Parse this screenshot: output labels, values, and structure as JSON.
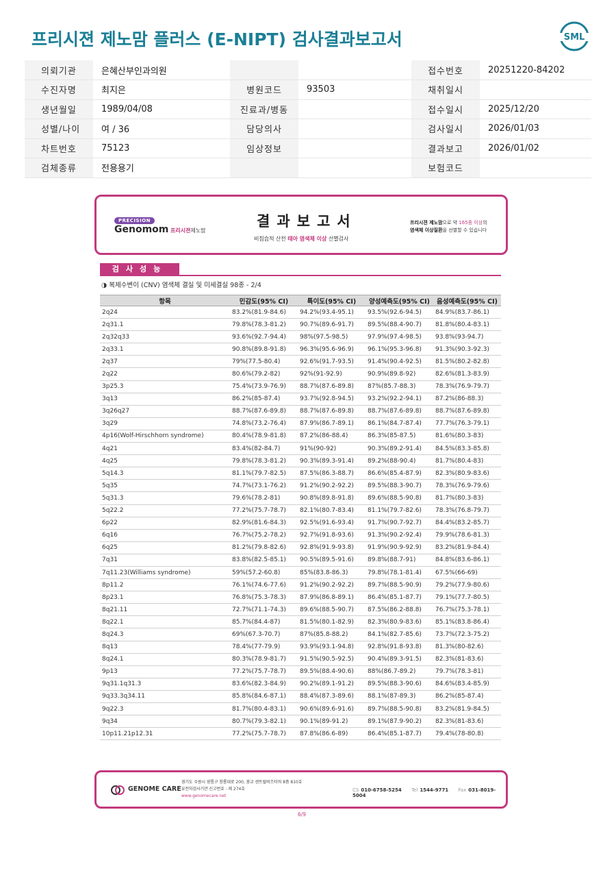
{
  "header": {
    "title": "프리시젼 제노맘 플러스 (E-NIPT) 검사결과보고서",
    "logo_text": "SML"
  },
  "patient_info": {
    "rows": [
      {
        "l1": "의뢰기관",
        "v1": "은혜산부인과의원",
        "l2": "",
        "v2": "",
        "l3": "접수번호",
        "v3": "20251220-84202"
      },
      {
        "l1": "수진자명",
        "v1": "최지은",
        "l2": "병원코드",
        "v2": "93503",
        "l3": "채취일시",
        "v3": ""
      },
      {
        "l1": "생년월일",
        "v1": "1989/04/08",
        "l2": "진료과/병동",
        "v2": "",
        "l3": "접수일시",
        "v3": "2025/12/20"
      },
      {
        "l1": "성별/나이",
        "v1": "여 / 36",
        "l2": "담당의사",
        "v2": "",
        "l3": "검사일시",
        "v3": "2026/01/03"
      },
      {
        "l1": "차트번호",
        "v1": "75123",
        "l2": "임상정보",
        "v2": "",
        "l3": "결과보고",
        "v3": "2026/01/02"
      },
      {
        "l1": "검체종류",
        "v1": "전용용기",
        "l2": "",
        "v2": "",
        "l3": "보험코드",
        "v3": ""
      }
    ]
  },
  "report": {
    "brand_tag": "PRECISION",
    "brand_name": "Genomom",
    "brand_sub_pink": "프리시젼",
    "brand_sub_dark": "제노맘",
    "title": "결과보고서",
    "subtitle_pre": "비침습적 산전 ",
    "subtitle_pink": "태아 염색체 이상",
    "subtitle_post": " 선별검사",
    "note_bold": "프리시젼 제노맘",
    "note_mid": "으로 약 ",
    "note_pink": "165종 이상",
    "note_end": "의",
    "note_line2_bold": "염색체 이상질환",
    "note_line2": "을 선별할 수 있습니다",
    "section_title": "검사성능",
    "section_subtitle": "◑ 복제수변이 (CNV) 염색체 결실 및 미세결실 98종 - 2/4"
  },
  "table": {
    "headers": [
      "항목",
      "민감도(95% CI)",
      "특이도(95% CI)",
      "양성예측도(95% CI)",
      "음성예측도(95% CI)"
    ],
    "rows": [
      [
        "2q24",
        "83.2%(81.9-84.6)",
        "94.2%(93.4-95.1)",
        "93.5%(92.6-94.5)",
        "84.9%(83.7-86.1)"
      ],
      [
        "2q31.1",
        "79.8%(78.3-81.2)",
        "90.7%(89.6-91.7)",
        "89.5%(88.4-90.7)",
        "81.8%(80.4-83.1)"
      ],
      [
        "2q32q33",
        "93.6%(92.7-94.4)",
        "98%(97.5-98.5)",
        "97.9%(97.4-98.5)",
        "93.8%(93-94.7)"
      ],
      [
        "2q33.1",
        "90.8%(89.8-91.8)",
        "96.3%(95.6-96.9)",
        "96.1%(95.3-96.8)",
        "91.3%(90.3-92.3)"
      ],
      [
        "2q37",
        "79%(77.5-80.4)",
        "92.6%(91.7-93.5)",
        "91.4%(90.4-92.5)",
        "81.5%(80.2-82.8)"
      ],
      [
        "2q22",
        "80.6%(79.2-82)",
        "92%(91-92.9)",
        "90.9%(89.8-92)",
        "82.6%(81.3-83.9)"
      ],
      [
        "3p25.3",
        "75.4%(73.9-76.9)",
        "88.7%(87.6-89.8)",
        "87%(85.7-88.3)",
        "78.3%(76.9-79.7)"
      ],
      [
        "3q13",
        "86.2%(85-87.4)",
        "93.7%(92.8-94.5)",
        "93.2%(92.2-94.1)",
        "87.2%(86-88.3)"
      ],
      [
        "3q26q27",
        "88.7%(87.6-89.8)",
        "88.7%(87.6-89.8)",
        "88.7%(87.6-89.8)",
        "88.7%(87.6-89.8)"
      ],
      [
        "3q29",
        "74.8%(73.2-76.4)",
        "87.9%(86.7-89.1)",
        "86.1%(84.7-87.4)",
        "77.7%(76.3-79.1)"
      ],
      [
        "4p16(Wolf-Hirschhorn syndrome)",
        "80.4%(78.9-81.8)",
        "87.2%(86-88.4)",
        "86.3%(85-87.5)",
        "81.6%(80.3-83)"
      ],
      [
        "4q21",
        "83.4%(82-84.7)",
        "91%(90-92)",
        "90.3%(89.2-91.4)",
        "84.5%(83.3-85.8)"
      ],
      [
        "4q25",
        "79.8%(78.3-81.2)",
        "90.3%(89.3-91.4)",
        "89.2%(88-90.4)",
        "81.7%(80.4-83)"
      ],
      [
        "5q14.3",
        "81.1%(79.7-82.5)",
        "87.5%(86.3-88.7)",
        "86.6%(85.4-87.9)",
        "82.3%(80.9-83.6)"
      ],
      [
        "5q35",
        "74.7%(73.1-76.2)",
        "91.2%(90.2-92.2)",
        "89.5%(88.3-90.7)",
        "78.3%(76.9-79.6)"
      ],
      [
        "5q31.3",
        "79.6%(78.2-81)",
        "90.8%(89.8-91.8)",
        "89.6%(88.5-90.8)",
        "81.7%(80.3-83)"
      ],
      [
        "5q22.2",
        "77.2%(75.7-78.7)",
        "82.1%(80.7-83.4)",
        "81.1%(79.7-82.6)",
        "78.3%(76.8-79.7)"
      ],
      [
        "6p22",
        "82.9%(81.6-84.3)",
        "92.5%(91.6-93.4)",
        "91.7%(90.7-92.7)",
        "84.4%(83.2-85.7)"
      ],
      [
        "6q16",
        "76.7%(75.2-78.2)",
        "92.7%(91.8-93.6)",
        "91.3%(90.2-92.4)",
        "79.9%(78.6-81.3)"
      ],
      [
        "6q25",
        "81.2%(79.8-82.6)",
        "92.8%(91.9-93.8)",
        "91.9%(90.9-92.9)",
        "83.2%(81.9-84.4)"
      ],
      [
        "7q31",
        "83.8%(82.5-85.1)",
        "90.5%(89.5-91.6)",
        "89.8%(88.7-91)",
        "84.8%(83.6-86.1)"
      ],
      [
        "7q11.23(Williams syndrome)",
        "59%(57.2-60.8)",
        "85%(83.8-86.3)",
        "79.8%(78.1-81.4)",
        "67.5%(66-69)"
      ],
      [
        "8p11.2",
        "76.1%(74.6-77.6)",
        "91.2%(90.2-92.2)",
        "89.7%(88.5-90.9)",
        "79.2%(77.9-80.6)"
      ],
      [
        "8p23.1",
        "76.8%(75.3-78.3)",
        "87.9%(86.8-89.1)",
        "86.4%(85.1-87.7)",
        "79.1%(77.7-80.5)"
      ],
      [
        "8q21.11",
        "72.7%(71.1-74.3)",
        "89.6%(88.5-90.7)",
        "87.5%(86.2-88.8)",
        "76.7%(75.3-78.1)"
      ],
      [
        "8q22.1",
        "85.7%(84.4-87)",
        "81.5%(80.1-82.9)",
        "82.3%(80.9-83.6)",
        "85.1%(83.8-86.4)"
      ],
      [
        "8q24.3",
        "69%(67.3-70.7)",
        "87%(85.8-88.2)",
        "84.1%(82.7-85.6)",
        "73.7%(72.3-75.2)"
      ],
      [
        "8q13",
        "78.4%(77-79.9)",
        "93.9%(93.1-94.8)",
        "92.8%(91.8-93.8)",
        "81.3%(80-82.6)"
      ],
      [
        "8q24.1",
        "80.3%(78.9-81.7)",
        "91.5%(90.5-92.5)",
        "90.4%(89.3-91.5)",
        "82.3%(81-83.6)"
      ],
      [
        "9p13",
        "77.2%(75.7-78.7)",
        "89.5%(88.4-90.6)",
        "88%(86.7-89.2)",
        "79.7%(78.3-81)"
      ],
      [
        "9q31.1q31.3",
        "83.6%(82.3-84.9)",
        "90.2%(89.1-91.2)",
        "89.5%(88.3-90.6)",
        "84.6%(83.4-85.9)"
      ],
      [
        "9q33.3q34.11",
        "85.8%(84.6-87.1)",
        "88.4%(87.3-89.6)",
        "88.1%(87-89.3)",
        "86.2%(85-87.4)"
      ],
      [
        "9q22.3",
        "81.7%(80.4-83.1)",
        "90.6%(89.6-91.6)",
        "89.7%(88.5-90.8)",
        "83.2%(81.9-84.5)"
      ],
      [
        "9q34",
        "80.7%(79.3-82.1)",
        "90.1%(89-91.2)",
        "89.1%(87.9-90.2)",
        "82.3%(81-83.6)"
      ],
      [
        "10p11.21p12.31",
        "77.2%(75.7-78.7)",
        "87.8%(86.6-89)",
        "86.4%(85.1-87.7)",
        "79.4%(78-80.8)"
      ]
    ]
  },
  "footer": {
    "company": "GENOME CARE",
    "address_line1": "경기도 수원시 영통구 창룡대로 200, 광교 센트럴비즈타워 8층 810호",
    "address_line2": "유전자검사기관 신고번호 : 제 274호",
    "website": "www.genomecare.net",
    "cs_label": "CS",
    "cs_value": "010-6758-5254",
    "tel_label": "Tel",
    "tel_value": "1544-9771",
    "fax_label": "Fax",
    "fax_value": "031-8019-5004",
    "page": "6/9"
  },
  "colors": {
    "title": "#1b7f96",
    "accent": "#c2397e",
    "logo": "#1b7f96"
  }
}
